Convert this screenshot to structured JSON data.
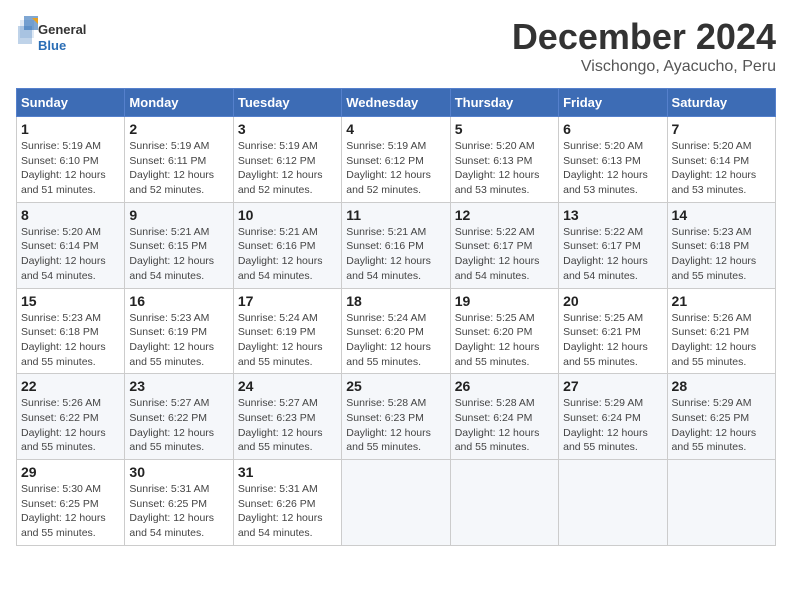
{
  "logo": {
    "line1": "General",
    "line2": "Blue"
  },
  "title": "December 2024",
  "subtitle": "Vischongo, Ayacucho, Peru",
  "weekdays": [
    "Sunday",
    "Monday",
    "Tuesday",
    "Wednesday",
    "Thursday",
    "Friday",
    "Saturday"
  ],
  "weeks": [
    [
      {
        "day": "1",
        "info": "Sunrise: 5:19 AM\nSunset: 6:10 PM\nDaylight: 12 hours\nand 51 minutes."
      },
      {
        "day": "2",
        "info": "Sunrise: 5:19 AM\nSunset: 6:11 PM\nDaylight: 12 hours\nand 52 minutes."
      },
      {
        "day": "3",
        "info": "Sunrise: 5:19 AM\nSunset: 6:12 PM\nDaylight: 12 hours\nand 52 minutes."
      },
      {
        "day": "4",
        "info": "Sunrise: 5:19 AM\nSunset: 6:12 PM\nDaylight: 12 hours\nand 52 minutes."
      },
      {
        "day": "5",
        "info": "Sunrise: 5:20 AM\nSunset: 6:13 PM\nDaylight: 12 hours\nand 53 minutes."
      },
      {
        "day": "6",
        "info": "Sunrise: 5:20 AM\nSunset: 6:13 PM\nDaylight: 12 hours\nand 53 minutes."
      },
      {
        "day": "7",
        "info": "Sunrise: 5:20 AM\nSunset: 6:14 PM\nDaylight: 12 hours\nand 53 minutes."
      }
    ],
    [
      {
        "day": "8",
        "info": "Sunrise: 5:20 AM\nSunset: 6:14 PM\nDaylight: 12 hours\nand 54 minutes."
      },
      {
        "day": "9",
        "info": "Sunrise: 5:21 AM\nSunset: 6:15 PM\nDaylight: 12 hours\nand 54 minutes."
      },
      {
        "day": "10",
        "info": "Sunrise: 5:21 AM\nSunset: 6:16 PM\nDaylight: 12 hours\nand 54 minutes."
      },
      {
        "day": "11",
        "info": "Sunrise: 5:21 AM\nSunset: 6:16 PM\nDaylight: 12 hours\nand 54 minutes."
      },
      {
        "day": "12",
        "info": "Sunrise: 5:22 AM\nSunset: 6:17 PM\nDaylight: 12 hours\nand 54 minutes."
      },
      {
        "day": "13",
        "info": "Sunrise: 5:22 AM\nSunset: 6:17 PM\nDaylight: 12 hours\nand 54 minutes."
      },
      {
        "day": "14",
        "info": "Sunrise: 5:23 AM\nSunset: 6:18 PM\nDaylight: 12 hours\nand 55 minutes."
      }
    ],
    [
      {
        "day": "15",
        "info": "Sunrise: 5:23 AM\nSunset: 6:18 PM\nDaylight: 12 hours\nand 55 minutes."
      },
      {
        "day": "16",
        "info": "Sunrise: 5:23 AM\nSunset: 6:19 PM\nDaylight: 12 hours\nand 55 minutes."
      },
      {
        "day": "17",
        "info": "Sunrise: 5:24 AM\nSunset: 6:19 PM\nDaylight: 12 hours\nand 55 minutes."
      },
      {
        "day": "18",
        "info": "Sunrise: 5:24 AM\nSunset: 6:20 PM\nDaylight: 12 hours\nand 55 minutes."
      },
      {
        "day": "19",
        "info": "Sunrise: 5:25 AM\nSunset: 6:20 PM\nDaylight: 12 hours\nand 55 minutes."
      },
      {
        "day": "20",
        "info": "Sunrise: 5:25 AM\nSunset: 6:21 PM\nDaylight: 12 hours\nand 55 minutes."
      },
      {
        "day": "21",
        "info": "Sunrise: 5:26 AM\nSunset: 6:21 PM\nDaylight: 12 hours\nand 55 minutes."
      }
    ],
    [
      {
        "day": "22",
        "info": "Sunrise: 5:26 AM\nSunset: 6:22 PM\nDaylight: 12 hours\nand 55 minutes."
      },
      {
        "day": "23",
        "info": "Sunrise: 5:27 AM\nSunset: 6:22 PM\nDaylight: 12 hours\nand 55 minutes."
      },
      {
        "day": "24",
        "info": "Sunrise: 5:27 AM\nSunset: 6:23 PM\nDaylight: 12 hours\nand 55 minutes."
      },
      {
        "day": "25",
        "info": "Sunrise: 5:28 AM\nSunset: 6:23 PM\nDaylight: 12 hours\nand 55 minutes."
      },
      {
        "day": "26",
        "info": "Sunrise: 5:28 AM\nSunset: 6:24 PM\nDaylight: 12 hours\nand 55 minutes."
      },
      {
        "day": "27",
        "info": "Sunrise: 5:29 AM\nSunset: 6:24 PM\nDaylight: 12 hours\nand 55 minutes."
      },
      {
        "day": "28",
        "info": "Sunrise: 5:29 AM\nSunset: 6:25 PM\nDaylight: 12 hours\nand 55 minutes."
      }
    ],
    [
      {
        "day": "29",
        "info": "Sunrise: 5:30 AM\nSunset: 6:25 PM\nDaylight: 12 hours\nand 55 minutes."
      },
      {
        "day": "30",
        "info": "Sunrise: 5:31 AM\nSunset: 6:25 PM\nDaylight: 12 hours\nand 54 minutes."
      },
      {
        "day": "31",
        "info": "Sunrise: 5:31 AM\nSunset: 6:26 PM\nDaylight: 12 hours\nand 54 minutes."
      },
      {
        "day": "",
        "info": ""
      },
      {
        "day": "",
        "info": ""
      },
      {
        "day": "",
        "info": ""
      },
      {
        "day": "",
        "info": ""
      }
    ]
  ]
}
